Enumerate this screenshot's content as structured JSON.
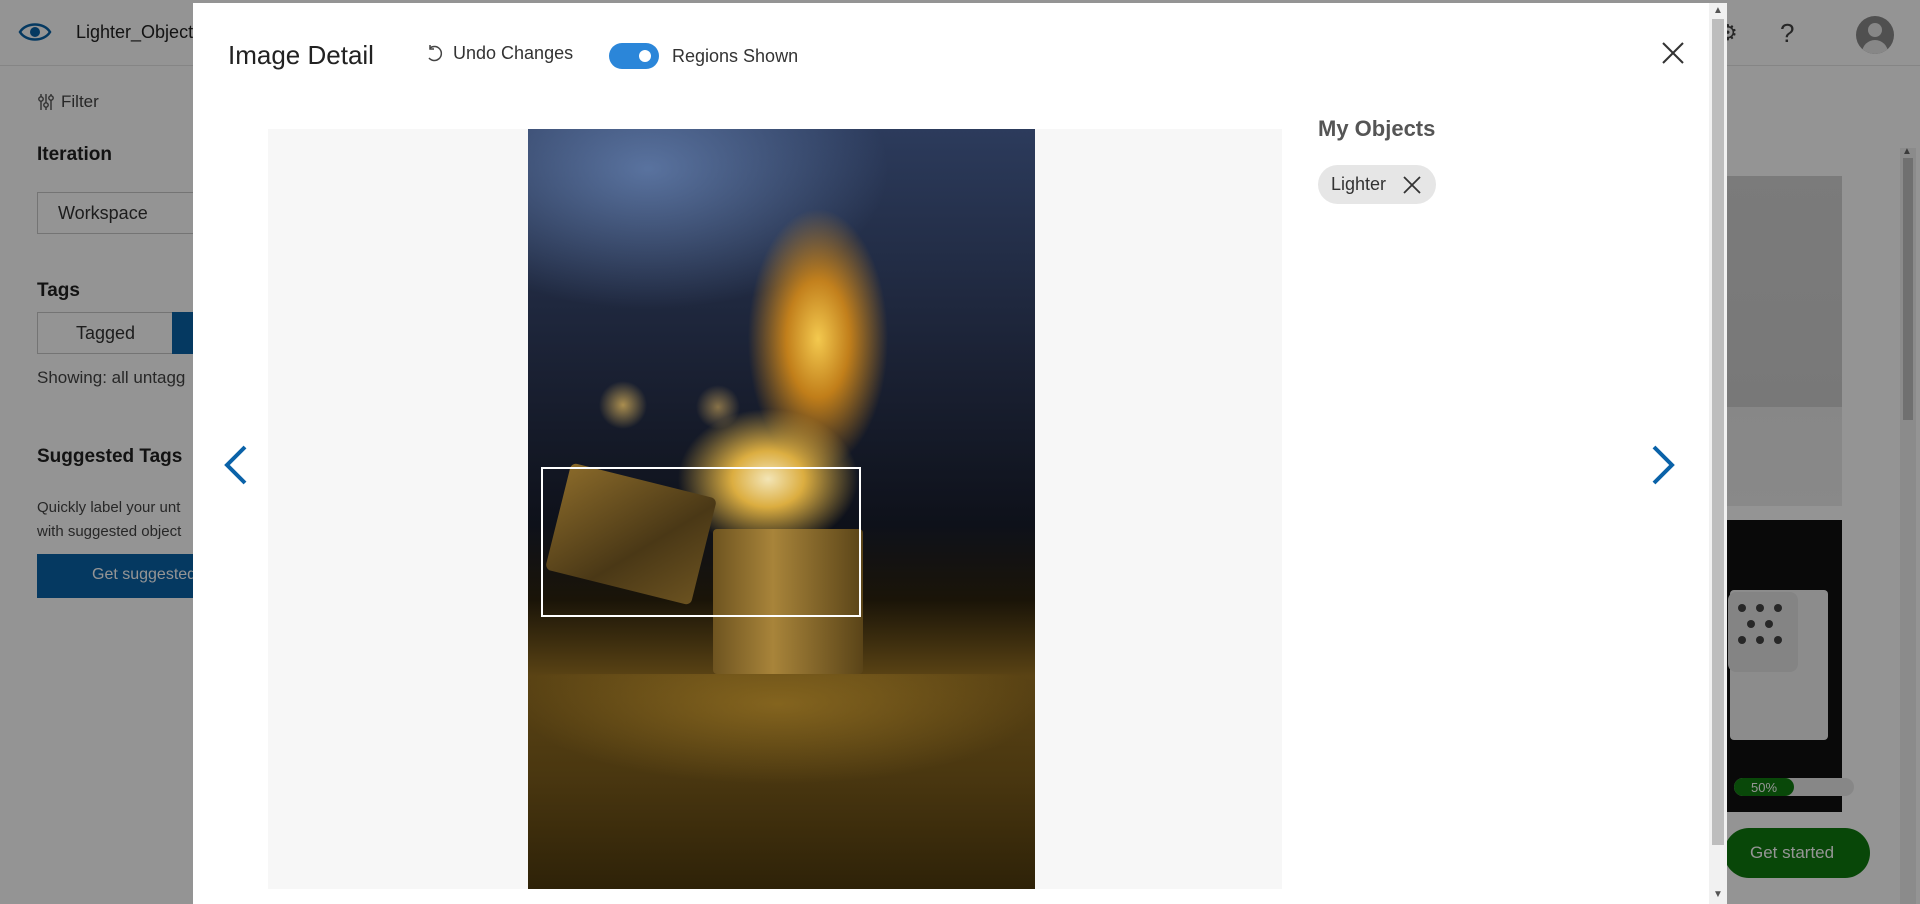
{
  "app": {
    "project_name": "Lighter_Object",
    "help_label": "?",
    "settings_glyph": "⚙"
  },
  "sidebar": {
    "filter_label": "Filter",
    "iteration_heading": "Iteration",
    "iteration_value": "Workspace",
    "tags_heading": "Tags",
    "tagged_label": "Tagged",
    "showing_text": "Showing: all untagg",
    "suggested_heading": "Suggested Tags",
    "suggested_desc_line1": "Quickly label your unt",
    "suggested_desc_line2": "with suggested object",
    "suggested_button": "Get suggested"
  },
  "gallery": {
    "progress_label": "50%",
    "progress_value": 0.5,
    "get_started_label": "Get started"
  },
  "modal": {
    "title": "Image Detail",
    "undo_label": "Undo Changes",
    "regions_label": "Regions Shown",
    "regions_on": true,
    "objects_heading": "My Objects",
    "objects": [
      {
        "label": "Lighter"
      }
    ]
  },
  "icons": {
    "logo": "eye-icon",
    "undo": "undo-icon",
    "close": "close-icon",
    "prev": "chevron-left-icon",
    "next": "chevron-right-icon",
    "remove": "remove-tag-icon"
  },
  "colors": {
    "accent": "#2b86d9",
    "primary_button": "#0a62a8",
    "success": "#107c10"
  }
}
